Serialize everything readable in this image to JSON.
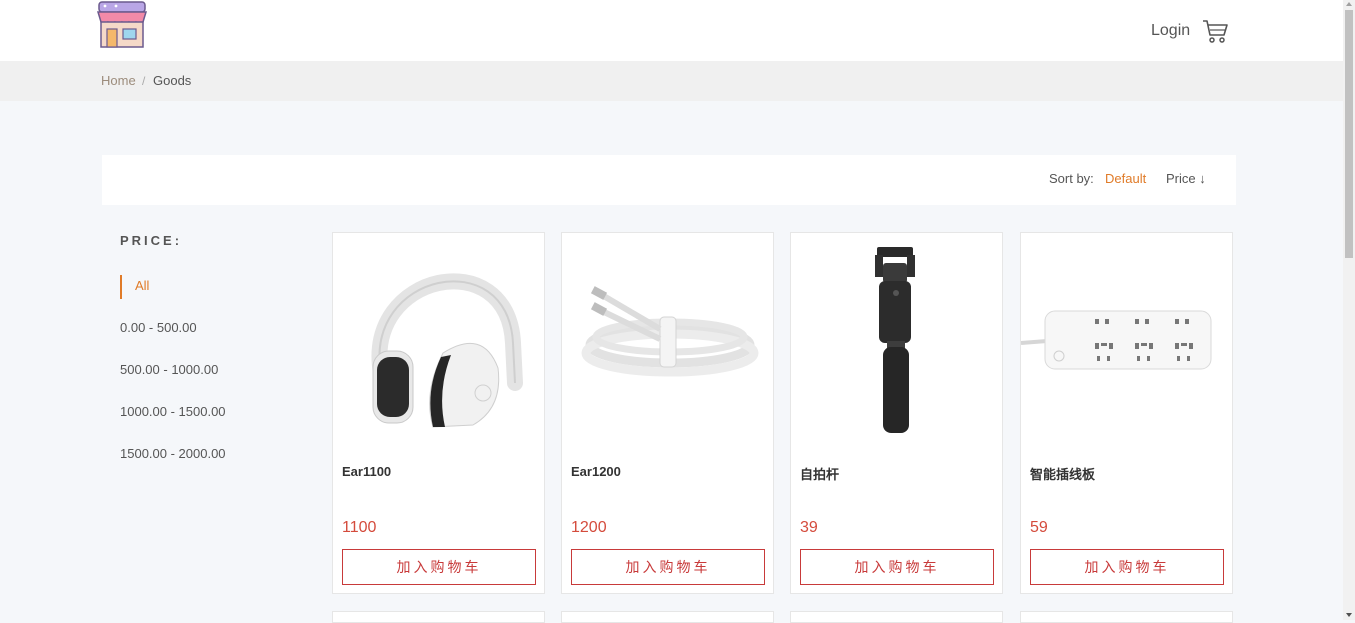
{
  "header": {
    "login_label": "Login"
  },
  "breadcrumb": {
    "home": "Home",
    "separator": "/",
    "current": "Goods"
  },
  "sort": {
    "label": "Sort by:",
    "default": "Default",
    "price": "Price ↓"
  },
  "filters": {
    "title": "PRICE:",
    "items": [
      "All",
      "0.00 - 500.00",
      "500.00 - 1000.00",
      "1000.00 - 1500.00",
      "1500.00 - 2000.00"
    ],
    "active": "All"
  },
  "products": [
    {
      "name": "Ear1100",
      "price": "1100",
      "button": "加入购物车",
      "image": "headphones"
    },
    {
      "name": "Ear1200",
      "price": "1200",
      "button": "加入购物车",
      "image": "usb-cable"
    },
    {
      "name": "自拍杆",
      "price": "39",
      "button": "加入购物车",
      "image": "selfie-stick"
    },
    {
      "name": "智能插线板",
      "price": "59",
      "button": "加入购物车",
      "image": "power-strip"
    }
  ],
  "colors": {
    "accent": "#e07b28",
    "price": "#d44b3c",
    "button": "#c83a3a"
  }
}
